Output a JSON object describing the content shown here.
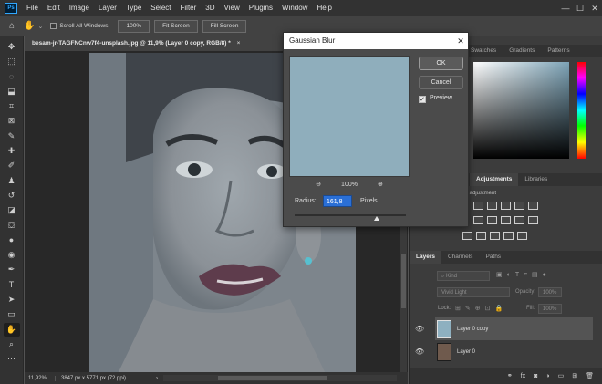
{
  "menubar": {
    "logo": "Ps",
    "items": [
      "File",
      "Edit",
      "Image",
      "Layer",
      "Type",
      "Select",
      "Filter",
      "3D",
      "View",
      "Plugins",
      "Window",
      "Help"
    ],
    "controls": [
      "—",
      "☐",
      "✕"
    ]
  },
  "options": {
    "scroll_all": "Scroll All Windows",
    "zoom_value": "100%",
    "fit_screen": "Fit Screen",
    "fill_screen": "Fill Screen"
  },
  "document": {
    "tab_title": "besam-jr-TAGFNCnw7f4-unsplash.jpg @ 11,9% (Layer 0 copy, RGB/8) *",
    "tab_close": "×",
    "zoom": "11,92%",
    "dimensions": "3847 px x 5771 px (72 ppi)"
  },
  "panels": {
    "top_tabs": [
      "Swatches",
      "Gradients",
      "Patterns"
    ],
    "mid_tabs": [
      "Adjustments",
      "Libraries"
    ],
    "adjustment_label": "Add an adjustment",
    "layer_tabs": [
      "Layers",
      "Channels",
      "Paths"
    ],
    "kind_placeholder": "Kind",
    "blend_mode": "Vivid Light",
    "opacity_label": "Opacity:",
    "opacity_value": "100%",
    "lock_label": "Lock:",
    "fill_label": "Fill:",
    "fill_value": "100%",
    "layers": [
      "Layer 0 copy",
      "Layer 0"
    ],
    "layer_footer_icons": [
      "GO",
      "fx",
      "mask",
      "adj",
      "folder",
      "new",
      "trash"
    ]
  },
  "dialog": {
    "title": "Gaussian Blur",
    "close": "✕",
    "ok": "OK",
    "cancel": "Cancel",
    "preview_label": "Preview",
    "preview_checked": "✓",
    "zoom_out": "⊖",
    "zoom_percent": "100%",
    "zoom_in": "⊕",
    "radius_label": "Radius:",
    "radius_value": "161,8",
    "radius_unit": "Pixels"
  },
  "colors": {
    "accent": "#2a6fd6",
    "preview": "#8faebc",
    "dialog_bg": "#4b4b4b"
  }
}
